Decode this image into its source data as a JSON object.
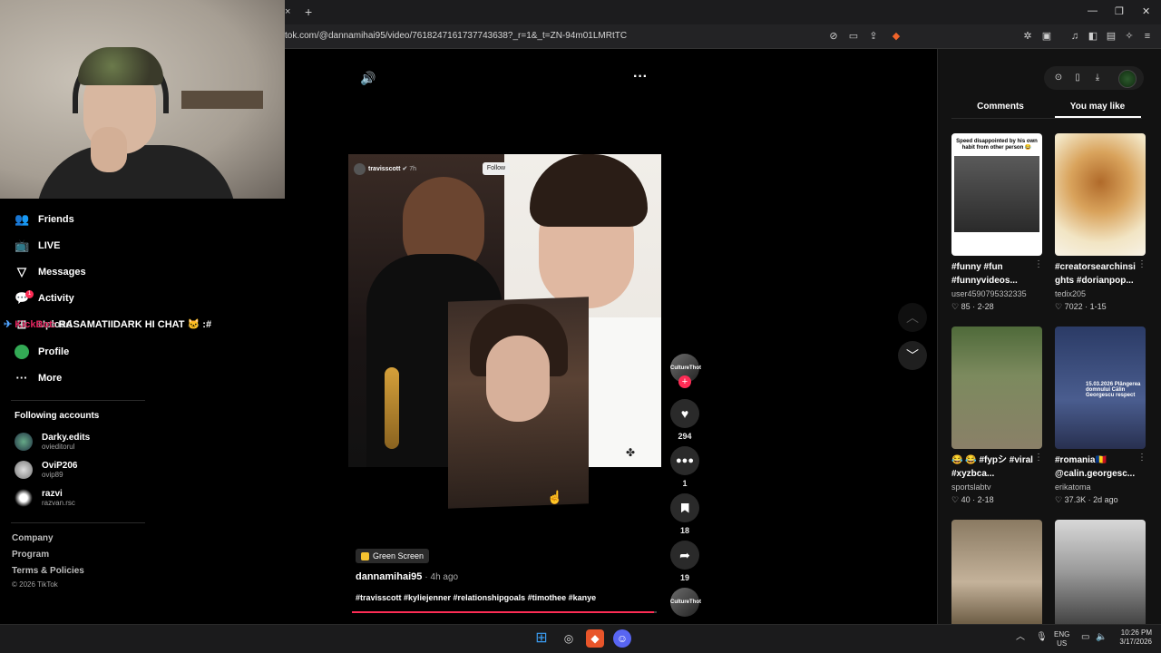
{
  "browser": {
    "url": "tok.com/@dannamihai95/video/7618247161737743638?_r=1&_t=ZN-94m01LMRtTC",
    "tab_close": "×",
    "tab_new": "+",
    "min": "—",
    "max": "❐",
    "close": "✕"
  },
  "sidebar": {
    "items": [
      {
        "label": "Friends",
        "icon": "friends-icon",
        "glyph": "👥"
      },
      {
        "label": "LIVE",
        "icon": "live-icon",
        "glyph": "📺"
      },
      {
        "label": "Messages",
        "icon": "messages-icon",
        "glyph": "▽"
      },
      {
        "label": "Activity",
        "icon": "activity-icon",
        "glyph": "💬"
      },
      {
        "label": "Upload",
        "icon": "upload-icon",
        "glyph": "⊞"
      },
      {
        "label": "Profile",
        "icon": "profile-icon",
        "glyph": "●"
      },
      {
        "label": "More",
        "icon": "more-icon",
        "glyph": "···"
      }
    ],
    "activity_badge": "1",
    "following_title": "Following accounts",
    "following": [
      {
        "name": "Darky.edits",
        "handle": "ovieditorul"
      },
      {
        "name": "OviP206",
        "handle": "ovip89"
      },
      {
        "name": "razvi",
        "handle": "razvan.rsc"
      }
    ],
    "footer": [
      "Company",
      "Program",
      "Terms & Policies"
    ],
    "copyright": "© 2026 TikTok"
  },
  "chat_overlay": {
    "user": "KickBot:",
    "message": "RASAMATIIDARK HI CHAT 🐱 :#"
  },
  "video": {
    "inner_username": "travisscott",
    "inner_time": "7h",
    "inner_follow": "Follow",
    "effect_label": "Green Screen",
    "author": "dannamihai95",
    "time": "· 4h ago",
    "hashtags": "#travisscott #kyliejenner #relationshipgoals #timothee #kanye",
    "progress": 0.99,
    "creator_avatar_text": "CultureThot",
    "actions": [
      {
        "name": "like",
        "glyph": "♥",
        "count": "294"
      },
      {
        "name": "comment",
        "glyph": "💬",
        "count": "1"
      },
      {
        "name": "save",
        "glyph": "🔖",
        "count": "18"
      },
      {
        "name": "share",
        "glyph": "➦",
        "count": "19"
      }
    ]
  },
  "panel": {
    "tabs": [
      "Comments",
      "You may like"
    ],
    "active_tab": 1,
    "items": [
      {
        "title": "#funny #fun #funnyvideos...",
        "user": "user4590795332335",
        "likes": "85",
        "date": "2-28",
        "caption": "Speed disappointed by his own habit from other person 😂",
        "bg": "#2e2e2e"
      },
      {
        "title": "#creatorsearchinsi ghts #dorianpop...",
        "user": "tedix205",
        "likes": "7022",
        "date": "1-15",
        "caption": "",
        "bg": "#e8d39a"
      },
      {
        "title": "😂 😂 #fypシ #viral #xyzbca...",
        "user": "sportslabtv",
        "likes": "40",
        "date": "2-18",
        "caption": "",
        "bg": "#6f7b55"
      },
      {
        "title": "#romania🇷🇴 @calin.georgesc...",
        "user": "erikatoma",
        "likes": "37.3K",
        "date": "2d ago",
        "caption": "15.03.2026 Plângerea domnului Călin Georgescu respect",
        "bg": "#3a4a70"
      },
      {
        "title": "",
        "user": "",
        "likes": "",
        "date": "",
        "caption": "",
        "bg": "#7a6a52"
      },
      {
        "title": "",
        "user": "",
        "likes": "",
        "date": "",
        "caption": "",
        "bg": "#bdbdbd"
      }
    ]
  },
  "taskbar": {
    "lang": "ENG",
    "region": "US",
    "time": "10:26 PM",
    "date": "3/17/2026"
  },
  "colors": {
    "accent": "#fe2c55",
    "bg": "#000000",
    "panel": "#121212"
  }
}
